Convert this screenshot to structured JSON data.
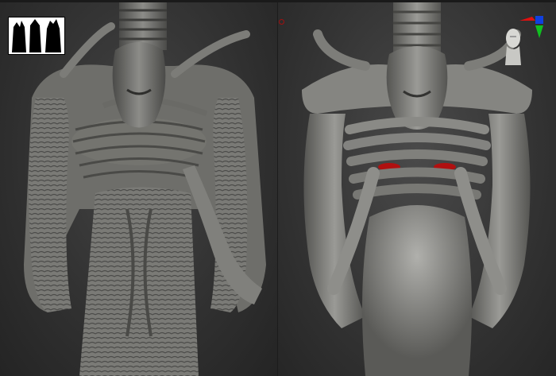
{
  "app": {
    "kind": "3d-sculpt-viewport"
  },
  "viewports": [
    {
      "id": "left",
      "shading": "detailed-sculpt-grey"
    },
    {
      "id": "right",
      "shading": "smooth-grey-with-red-accents"
    }
  ],
  "icons": {
    "thumbnail": "silhouette-thumbnail-icon",
    "record": "record-dot-icon",
    "axis": "axis-gizmo-icon",
    "head": "head-orientation-icon"
  },
  "colors": {
    "background": "#2e2e2e",
    "clay": "#8a8a86",
    "clay_shadow": "#3a3a38",
    "accent_red": "#b01010",
    "axis_x": "#e01010",
    "axis_y": "#10c020",
    "axis_z": "#1040e0"
  }
}
